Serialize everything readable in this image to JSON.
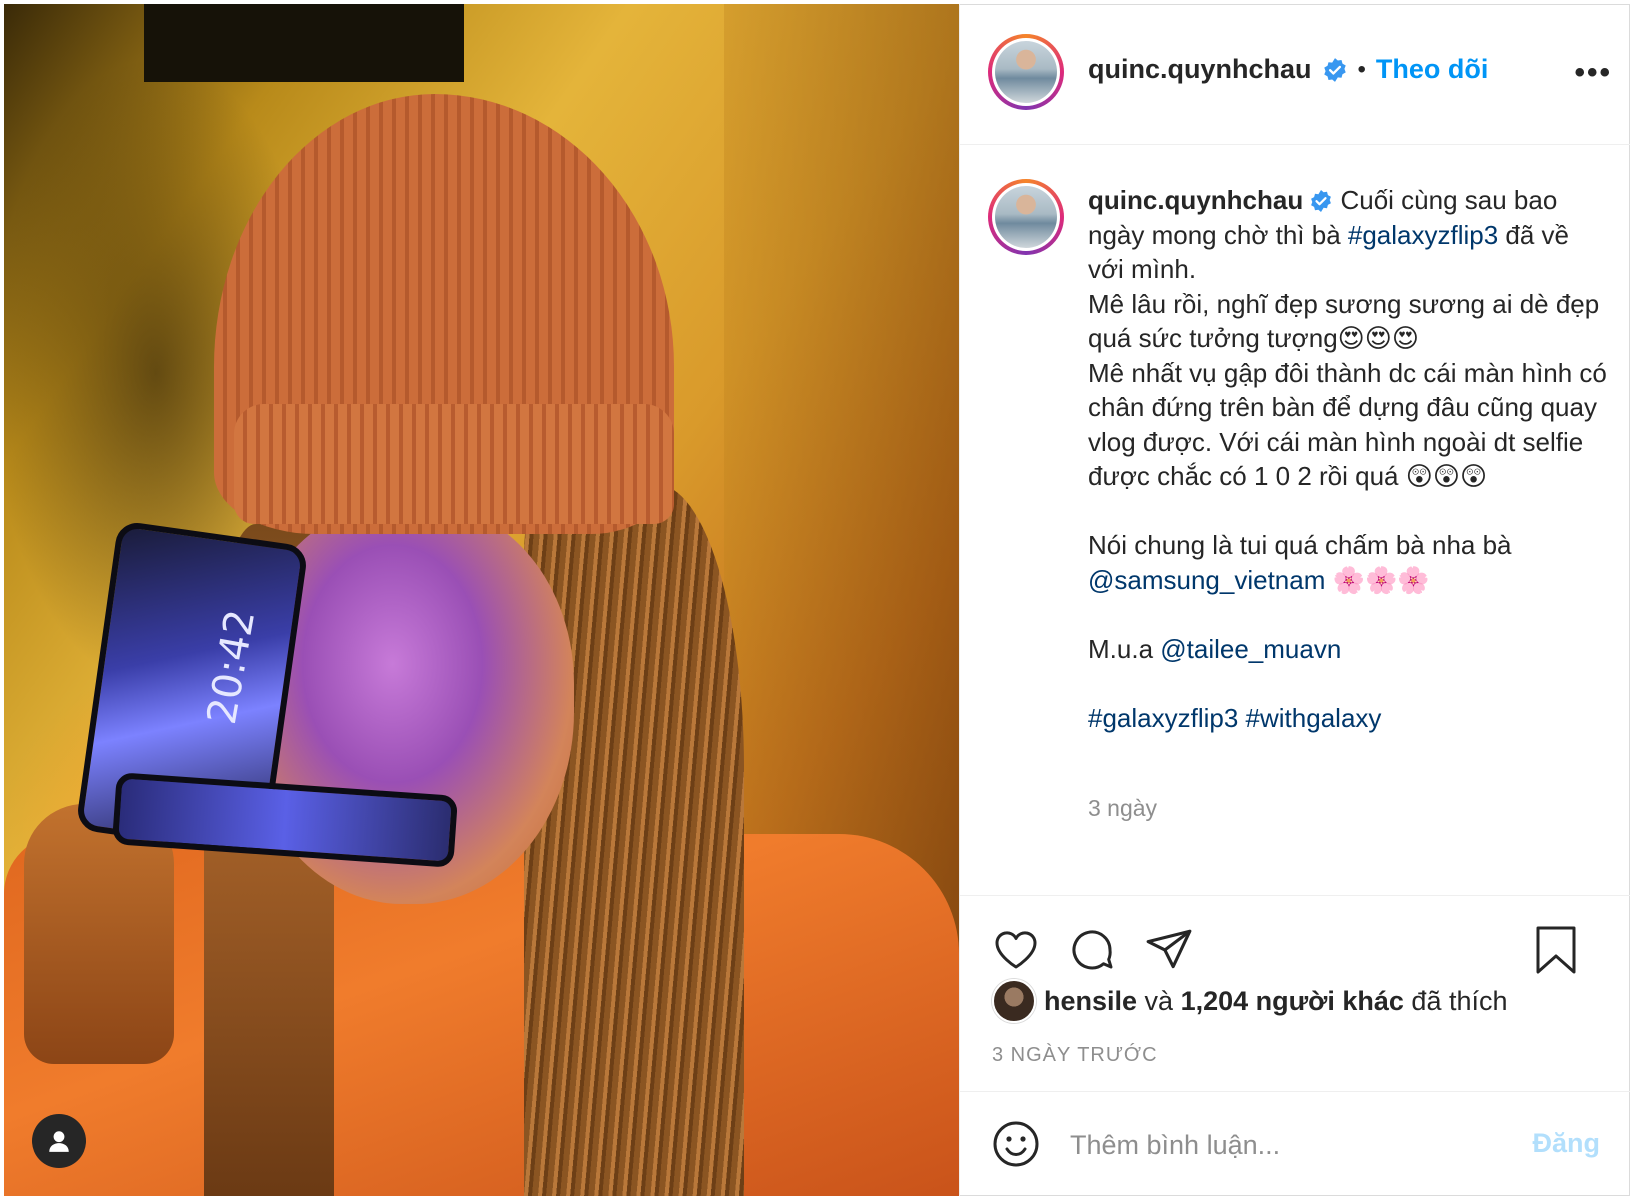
{
  "post": {
    "username": "quinc.quynhchau",
    "follow_label": "Theo dõi",
    "separator": "•",
    "more_label": "•••"
  },
  "caption": {
    "username": "quinc.quynhchau",
    "lines": {
      "t1": " Cuối cùng sau bao ngày mong chờ thì bà ",
      "tag1": "#galaxyzflip3",
      "t2": " đã về với mình.\nMê lâu rồi, nghĩ đẹp sương sương ai dè đẹp quá sức tưởng tượng😍😍😍\nMê nhất vụ gập đôi thành dc cái màn hình có chân đứng trên bàn để dựng đâu cũng quay vlog được. Với cái màn hình ngoài dt selfie được chắc có 1 0 2 rồi quá 😲😲😲\n\nNói chung là tui quá chấm bà nha bà\n",
      "mention1": "@samsung_vietnam",
      "t3": " 🌸🌸🌸\n\nM.u.a ",
      "mention2": "@tailee_muavn",
      "t4": "\n\n",
      "tag2": "#galaxyzflip3",
      "t5": " ",
      "tag3": "#withgalaxy"
    },
    "time": "3 ngày"
  },
  "engagement": {
    "liker": "hensile",
    "and": " và ",
    "count": "1,204 người khác",
    "suffix": " đã thích",
    "ago": "3 NGÀY TRƯỚC"
  },
  "comment": {
    "placeholder": "Thêm bình luận...",
    "post_label": "Đăng"
  },
  "photo": {
    "clock": "20:42"
  },
  "colors": {
    "accent": "#0095f6",
    "link": "#00376b",
    "verified": "#3897f0",
    "post_disabled": "#b2dffc"
  }
}
